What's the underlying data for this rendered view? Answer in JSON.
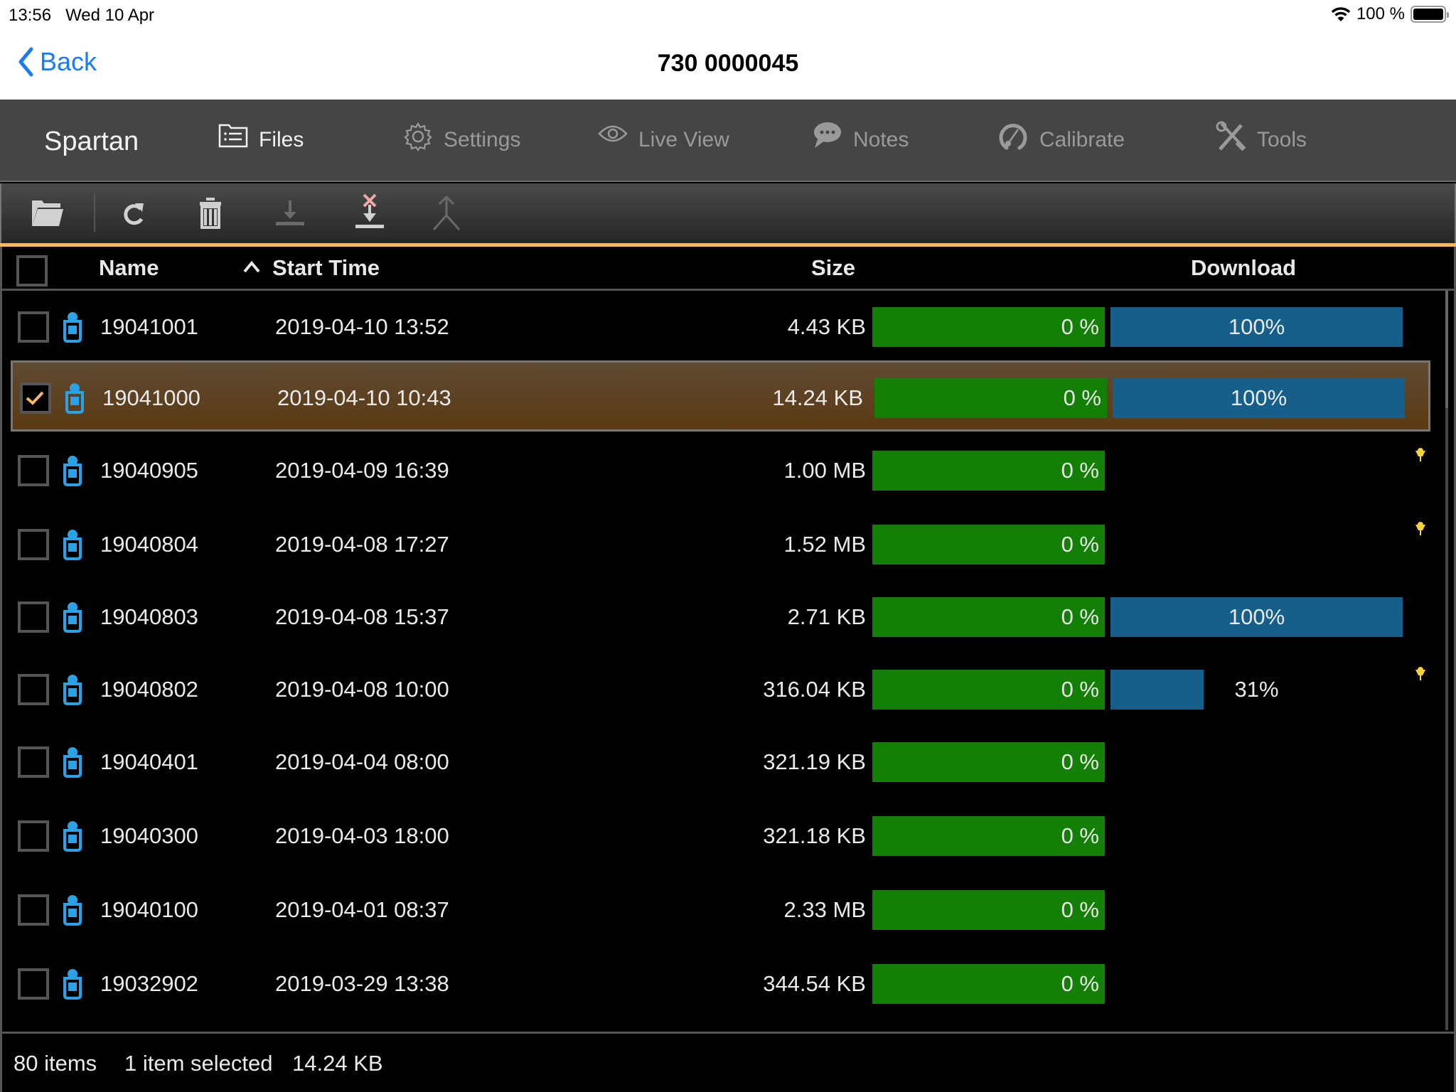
{
  "status_bar": {
    "time": "13:56",
    "date": "Wed 10 Apr",
    "battery": "100 %"
  },
  "nav": {
    "back_label": "Back",
    "title": "730 0000045"
  },
  "tabs": {
    "brand": "Spartan",
    "items": [
      {
        "label": "Files",
        "icon": "files-icon",
        "active": true
      },
      {
        "label": "Settings",
        "icon": "gear-icon",
        "active": false
      },
      {
        "label": "Live View",
        "icon": "eye-icon",
        "active": false
      },
      {
        "label": "Notes",
        "icon": "chat-bubble-icon",
        "active": false
      },
      {
        "label": "Calibrate",
        "icon": "gauge-icon",
        "active": false
      },
      {
        "label": "Tools",
        "icon": "wrench-screwdriver-icon",
        "active": false
      }
    ]
  },
  "toolbar": {
    "buttons": [
      {
        "name": "open-folder",
        "icon": "folder-open-icon",
        "enabled": true
      },
      {
        "name": "refresh",
        "icon": "refresh-icon",
        "enabled": true
      },
      {
        "name": "delete",
        "icon": "trash-icon",
        "enabled": true
      },
      {
        "name": "download",
        "icon": "download-icon",
        "enabled": false
      },
      {
        "name": "cancel-download",
        "icon": "cancel-download-icon",
        "enabled": true
      },
      {
        "name": "merge",
        "icon": "merge-icon",
        "enabled": false
      }
    ]
  },
  "table": {
    "headers": {
      "name": "Name",
      "start_time": "Start Time",
      "size": "Size",
      "download": "Download"
    },
    "sort": {
      "column": "start_time",
      "direction": "descending-arrow-up"
    },
    "rows": [
      {
        "name": "19041001",
        "start": "2019-04-10 13:52",
        "size": "4.43 KB",
        "progress_label": "0 %",
        "download_pct": 100,
        "download_label": "100%",
        "selected": false,
        "pin": false
      },
      {
        "name": "19041000",
        "start": "2019-04-10 10:43",
        "size": "14.24 KB",
        "progress_label": "0 %",
        "download_pct": 100,
        "download_label": "100%",
        "selected": true,
        "pin": false
      },
      {
        "name": "19040905",
        "start": "2019-04-09 16:39",
        "size": "1.00 MB",
        "progress_label": "0 %",
        "download_pct": null,
        "download_label": "",
        "selected": false,
        "pin": true
      },
      {
        "name": "19040804",
        "start": "2019-04-08 17:27",
        "size": "1.52 MB",
        "progress_label": "0 %",
        "download_pct": null,
        "download_label": "",
        "selected": false,
        "pin": true
      },
      {
        "name": "19040803",
        "start": "2019-04-08 15:37",
        "size": "2.71 KB",
        "progress_label": "0 %",
        "download_pct": 100,
        "download_label": "100%",
        "selected": false,
        "pin": false
      },
      {
        "name": "19040802",
        "start": "2019-04-08 10:00",
        "size": "316.04 KB",
        "progress_label": "0 %",
        "download_pct": 31,
        "download_label": "31%",
        "selected": false,
        "pin": true
      },
      {
        "name": "19040401",
        "start": "2019-04-04 08:00",
        "size": "321.19 KB",
        "progress_label": "0 %",
        "download_pct": null,
        "download_label": "",
        "selected": false,
        "pin": false
      },
      {
        "name": "19040300",
        "start": "2019-04-03 18:00",
        "size": "321.18 KB",
        "progress_label": "0 %",
        "download_pct": null,
        "download_label": "",
        "selected": false,
        "pin": false
      },
      {
        "name": "19040100",
        "start": "2019-04-01 08:37",
        "size": "2.33 MB",
        "progress_label": "0 %",
        "download_pct": null,
        "download_label": "",
        "selected": false,
        "pin": false
      },
      {
        "name": "19032902",
        "start": "2019-03-29 13:38",
        "size": "344.54 KB",
        "progress_label": "0 %",
        "download_pct": null,
        "download_label": "",
        "selected": false,
        "pin": false
      }
    ]
  },
  "footer": {
    "count": "80 items",
    "selected": "1 item selected",
    "selected_size": "14.24 KB"
  },
  "colors": {
    "accent": "#f7b866",
    "progress_green": "#137f06",
    "download_blue": "#155f8a",
    "selected_row": "#5a3a12",
    "link_blue": "#1a7cf0",
    "pin_yellow": "#f5d33c",
    "device_icon": "#2aa2e6"
  }
}
